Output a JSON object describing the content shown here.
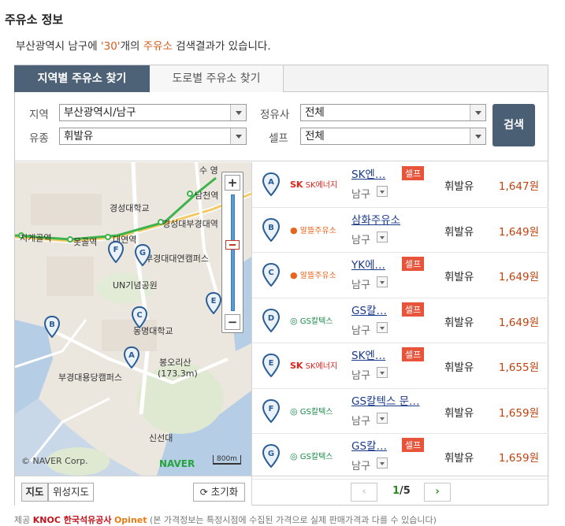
{
  "page": {
    "title": "주유소 정보",
    "result_prefix": "부산광역시 남구에 ",
    "result_count": "'30'",
    "result_mid": "개의 ",
    "result_kind": "주유소",
    "result_suffix": " 검색결과가 있습니다."
  },
  "tabs": [
    "지역별 주유소 찾기",
    "도로별 주유소 찾기"
  ],
  "filters": {
    "region_label": "지역",
    "region_value": "부산광역시/남구",
    "oil_label": "유종",
    "oil_value": "휘발유",
    "brand_label": "정유사",
    "brand_value": "전체",
    "self_label": "셀프",
    "self_value": "전체",
    "search_label": "검색"
  },
  "map": {
    "labels": {
      "namcheon": "남천역",
      "gyeongsung_univ": "경성대학교",
      "gyeongsung_station": "경성대부경대역",
      "jigegol": "지게골역",
      "motgol": "못골역",
      "daeyeon": "대연역",
      "pknu_campus": "부경대대연캠퍼스",
      "un_park": "UN기념공원",
      "dongmyung": "동명대학교",
      "pknu_yongdang": "부경대용당캠퍼스",
      "bongori": "봉오리산",
      "bongori_h": "(173.3m)",
      "sinseondae": "신선대",
      "suyeong": "수 영"
    },
    "copyright": "© NAVER Corp.",
    "brand": "NAVER",
    "scale": "800m",
    "zoom_in": "+",
    "zoom_out": "−",
    "btn_map": "지도",
    "btn_satellite": "위성지도",
    "btn_reset": "초기화"
  },
  "stations": [
    {
      "marker": "A",
      "brand_text": "SK에너지",
      "name": "SK엔…",
      "self": "셀프",
      "district": "남구",
      "fuel": "휘발유",
      "price": "1,647원"
    },
    {
      "marker": "B",
      "brand_text": "알뜰주유소",
      "name": "삼화주유소",
      "self": "",
      "district": "남구",
      "fuel": "휘발유",
      "price": "1,649원"
    },
    {
      "marker": "C",
      "brand_text": "알뜰주유소",
      "name": "YK에…",
      "self": "셀프",
      "district": "남구",
      "fuel": "휘발유",
      "price": "1,649원"
    },
    {
      "marker": "D",
      "brand_text": "GS칼텍스",
      "name": "GS칼…",
      "self": "셀프",
      "district": "남구",
      "fuel": "휘발유",
      "price": "1,649원"
    },
    {
      "marker": "E",
      "brand_text": "SK에너지",
      "name": "SK엔…",
      "self": "셀프",
      "district": "남구",
      "fuel": "휘발유",
      "price": "1,655원"
    },
    {
      "marker": "F",
      "brand_text": "GS칼텍스",
      "name": "GS칼텍스 문…",
      "self": "",
      "district": "남구",
      "fuel": "휘발유",
      "price": "1,659원"
    },
    {
      "marker": "G",
      "brand_text": "GS칼텍스",
      "name": "GS칼…",
      "self": "셀프",
      "district": "남구",
      "fuel": "휘발유",
      "price": "1,659원"
    }
  ],
  "pager": {
    "current": "1",
    "total": "/5",
    "prev": "‹",
    "next": "›"
  },
  "footer": {
    "provider_label": "제공",
    "knoc": "KNOC 한국석유공사",
    "opinet": "Opinet",
    "disclaimer": "(본 가격정보는 특정시점에 수집된 가격으로 실제 판매가격과 다를 수 있습니다)"
  },
  "colors": {
    "tab_active": "#4d6277",
    "price": "#c0420f",
    "self_badge": "#e8543a",
    "highlight": "#d85a1a"
  }
}
